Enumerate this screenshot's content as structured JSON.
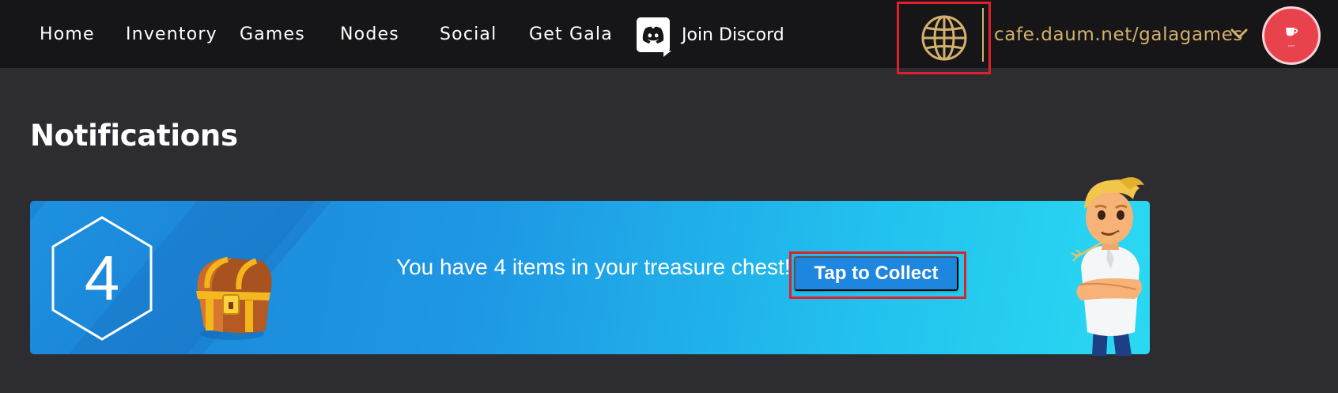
{
  "nav": {
    "links": [
      {
        "label": "Home"
      },
      {
        "label": "Inventory"
      },
      {
        "label": "Games"
      },
      {
        "label": "Nodes"
      },
      {
        "label": "Social"
      },
      {
        "label": "Get Gala"
      }
    ],
    "discord_label": "Join Discord",
    "account_url": "cafe.daum.net/galagames",
    "icons": {
      "discord": "discord-icon",
      "globe": "globe-icon",
      "chevron": "chevron-down-icon",
      "avatar": "cafe-cup-icon"
    }
  },
  "page": {
    "title": "Notifications"
  },
  "notification": {
    "count": "4",
    "message": "You have 4 items in your treasure chest!",
    "cta_label": "Tap to Collect"
  },
  "colors": {
    "topbar": "#161618",
    "page_bg": "#2c2c31",
    "accent_gold": "#d4b06a",
    "banner_start": "#1b85d6",
    "banner_end": "#2bd9f2",
    "cta_button": "#1f86e0",
    "highlight_outline": "#e01f2b",
    "avatar_red": "#e8434d"
  }
}
